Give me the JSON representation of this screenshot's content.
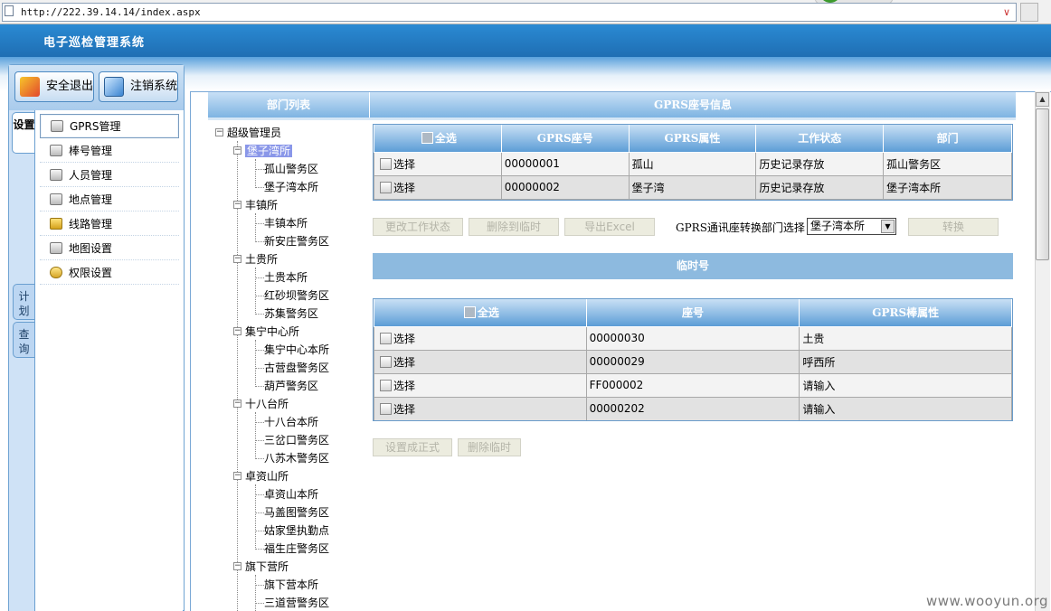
{
  "browser": {
    "url": "http://222.39.14.14/index.aspx",
    "dropdown_glyph": "∨"
  },
  "header": {
    "title": "电子巡检管理系统"
  },
  "toolbar": {
    "logout_label": "安全退出",
    "cancel_label": "注销系统"
  },
  "side_tabs": [
    {
      "label": "设置",
      "active": true
    },
    {
      "label": "计划",
      "active": false
    },
    {
      "label": "查询",
      "active": false
    }
  ],
  "menu": [
    {
      "label": "GPRS管理",
      "icon": "server-icon",
      "selected": true
    },
    {
      "label": "棒号管理",
      "icon": "check-icon",
      "selected": false
    },
    {
      "label": "人员管理",
      "icon": "people-icon",
      "selected": false
    },
    {
      "label": "地点管理",
      "icon": "location-icon",
      "selected": false
    },
    {
      "label": "线路管理",
      "icon": "lock-icon",
      "selected": false
    },
    {
      "label": "地图设置",
      "icon": "map-icon",
      "selected": false
    },
    {
      "label": "权限设置",
      "icon": "key-icon",
      "selected": false
    }
  ],
  "dept_panel": {
    "title": "部门列表",
    "root": "超级管理员",
    "groups": [
      {
        "name": "堡子湾所",
        "highlighted": true,
        "children": [
          "孤山警务区",
          "堡子湾本所"
        ]
      },
      {
        "name": "丰镇所",
        "highlighted": false,
        "children": [
          "丰镇本所",
          "新安庄警务区"
        ]
      },
      {
        "name": "土贵所",
        "highlighted": false,
        "children": [
          "土贵本所",
          "红砂坝警务区",
          "苏集警务区"
        ]
      },
      {
        "name": "集宁中心所",
        "highlighted": false,
        "children": [
          "集宁中心本所",
          "古营盘警务区",
          "葫芦警务区"
        ]
      },
      {
        "name": "十八台所",
        "highlighted": false,
        "children": [
          "十八台本所",
          "三岔口警务区",
          "八苏木警务区"
        ]
      },
      {
        "name": "卓资山所",
        "highlighted": false,
        "children": [
          "卓资山本所",
          "马盖图警务区",
          "姑家堡执勤点",
          "福生庄警务区"
        ]
      },
      {
        "name": "旗下营所",
        "highlighted": false,
        "children": [
          "旗下营本所",
          "三道营警务区"
        ]
      }
    ]
  },
  "gprs_panel": {
    "title": "GPRS座号信息",
    "columns": [
      "全选",
      "GPRS座号",
      "GPRS属性",
      "工作状态",
      "部门"
    ],
    "rows": [
      {
        "select": "选择",
        "number": "00000001",
        "attr": "孤山",
        "status": "历史记录存放",
        "dept": "孤山警务区"
      },
      {
        "select": "选择",
        "number": "00000002",
        "attr": "堡子湾",
        "status": "历史记录存放",
        "dept": "堡子湾本所"
      }
    ],
    "buttons": {
      "change_status": "更改工作状态",
      "delete_to_temp": "删除到临时",
      "export_excel": "导出Excel",
      "convert": "转换"
    },
    "convert_label": "GPRS通讯座转换部门选择：",
    "dept_select_value": "堡子湾本所"
  },
  "temp_panel": {
    "title": "临时号",
    "columns": [
      "全选",
      "座号",
      "GPRS棒属性"
    ],
    "rows": [
      {
        "select": "选择",
        "number": "00000030",
        "attr": "土贵"
      },
      {
        "select": "选择",
        "number": "00000029",
        "attr": "呼西所"
      },
      {
        "select": "选择",
        "number": "FF000002",
        "attr": "请输入"
      },
      {
        "select": "选择",
        "number": "00000202",
        "attr": "请输入"
      }
    ],
    "buttons": {
      "set_formal": "设置成正式",
      "delete_temp": "删除临时"
    }
  },
  "watermark": "www.wooyun.org"
}
